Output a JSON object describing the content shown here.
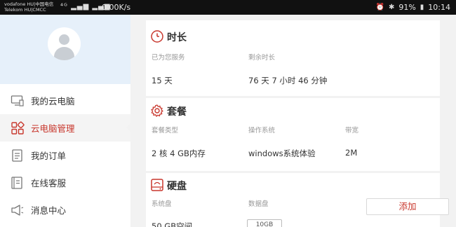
{
  "status_bar": {
    "carrier_line1": "vodafone HU|中国电信",
    "carrier_line2": "Telekom HU|CMCC",
    "signal_icons": "⁴ᴳ ▂▄▆ ▂▄▆",
    "net_speed": "0.00K/s",
    "alarm_icon": "alarm-clock-icon",
    "bluetooth_icon": "bluetooth-icon",
    "battery": "91%",
    "time": "10:14"
  },
  "sidebar": {
    "items": [
      {
        "label": "我的云电脑",
        "icon": "monitor-icon"
      },
      {
        "label": "云电脑管理",
        "icon": "grid-manage-icon"
      },
      {
        "label": "我的订单",
        "icon": "document-icon"
      },
      {
        "label": "在线客服",
        "icon": "service-book-icon"
      },
      {
        "label": "消息中心",
        "icon": "megaphone-icon"
      }
    ]
  },
  "sections": {
    "duration": {
      "title": "时长",
      "served_label": "已为您服务",
      "served_value": "15 天",
      "remaining_label": "剩余时长",
      "remaining_value": "76 天 7 小时 46 分钟"
    },
    "package": {
      "title": "套餐",
      "type_label": "套餐类型",
      "type_value": "2 核 4 GB内存",
      "os_label": "操作系统",
      "os_value": "windows系统体验",
      "bandwidth_label": "带宽",
      "bandwidth_value": "2M"
    },
    "disk": {
      "title": "硬盘",
      "system_label": "系统盘",
      "system_value": "50 GB空间",
      "data_label": "数据盘",
      "data_value": "10GB",
      "add_label": "添加"
    }
  },
  "colors": {
    "accent": "#c8372d",
    "profile_bg": "#e6f0fa",
    "statusbar_bg": "#111111"
  }
}
